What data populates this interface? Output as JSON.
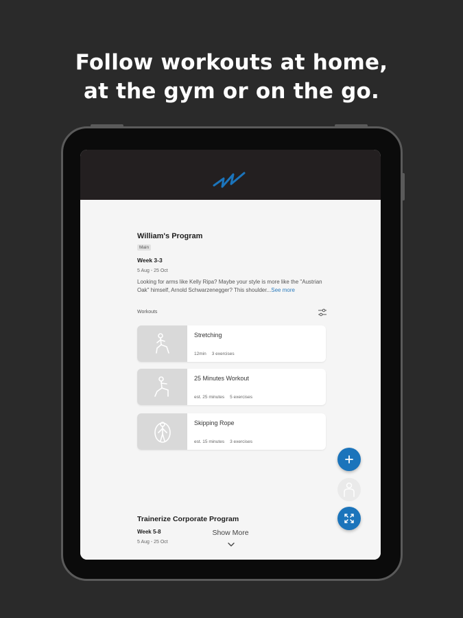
{
  "headline": {
    "line1": "Follow workouts at home,",
    "line2": "at the gym or on the go."
  },
  "colors": {
    "background": "#2a2a2a",
    "app_header": "#231f20",
    "accent": "#1b74bb",
    "link": "#2b7bbd"
  },
  "program": {
    "title": "William's Program",
    "tag": "Main",
    "week": "Week 3-3",
    "dates": "5 Aug - 25 Oct",
    "description": "Looking for arms like Kelly Ripa? Maybe your style is more like the \"Austrian Oak\" himself, Arnold Schwarzenegger? This shoulder...",
    "see_more": "See more",
    "workouts_label": "Workouts",
    "filter_icon": "sliders-icon"
  },
  "workouts": [
    {
      "name": "Stretching",
      "duration": "12min",
      "exercises": "3 exercises",
      "icon": "lunge-figure-icon"
    },
    {
      "name": "25 Minutes Workout",
      "duration": "est. 25 minutes",
      "exercises": "5 exercises",
      "icon": "squat-figure-icon"
    },
    {
      "name": "Skipping Rope",
      "duration": "est. 15 minutes",
      "exercises": "3 exercises",
      "icon": "jump-rope-figure-icon"
    }
  ],
  "program2": {
    "title": "Trainerize Corporate Program",
    "week": "Week 5-8",
    "dates": "5 Aug - 25 Oct"
  },
  "show_more": "Show More",
  "fabs": [
    {
      "icon": "plus-icon"
    },
    {
      "icon": "person-icon"
    },
    {
      "icon": "move-arrows-icon"
    }
  ]
}
